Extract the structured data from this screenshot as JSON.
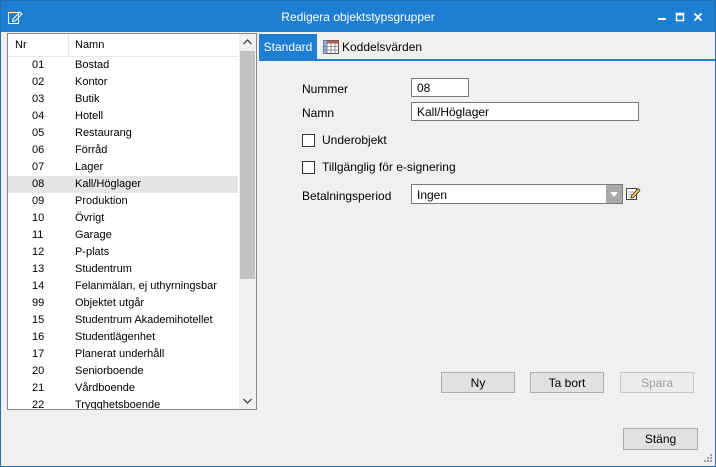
{
  "window": {
    "title": "Redigera objektstypsgrupper",
    "icons": {
      "app": "edit-note-icon",
      "minimize": "minimize-icon",
      "maximize": "maximize-icon",
      "close": "close-icon"
    },
    "accent_color": "#1e7fd2"
  },
  "list": {
    "columns": {
      "nr": "Nr",
      "name": "Namn"
    },
    "selected_nr": "08",
    "rows": [
      {
        "nr": "01",
        "name": "Bostad"
      },
      {
        "nr": "02",
        "name": "Kontor"
      },
      {
        "nr": "03",
        "name": "Butik"
      },
      {
        "nr": "04",
        "name": "Hotell"
      },
      {
        "nr": "05",
        "name": "Restaurang"
      },
      {
        "nr": "06",
        "name": "Förråd"
      },
      {
        "nr": "07",
        "name": "Lager"
      },
      {
        "nr": "08",
        "name": "Kall/Höglager"
      },
      {
        "nr": "09",
        "name": "Produktion"
      },
      {
        "nr": "10",
        "name": "Övrigt"
      },
      {
        "nr": "11",
        "name": "Garage"
      },
      {
        "nr": "12",
        "name": "P-plats"
      },
      {
        "nr": "13",
        "name": "Studentrum"
      },
      {
        "nr": "14",
        "name": "Felanmälan, ej uthyrningsbar"
      },
      {
        "nr": "99",
        "name": "Objektet utgår"
      },
      {
        "nr": "15",
        "name": "Studentrum Akademihotellet"
      },
      {
        "nr": "16",
        "name": "Studentlägenhet"
      },
      {
        "nr": "17",
        "name": "Planerat underhåll"
      },
      {
        "nr": "20",
        "name": "Seniorboende"
      },
      {
        "nr": "21",
        "name": "Vårdboende"
      },
      {
        "nr": "22",
        "name": "Trygghetsboende"
      }
    ]
  },
  "tabs": [
    {
      "label": "Standard",
      "active": true
    },
    {
      "label": "Koddelsvärden",
      "active": false,
      "icon": "table-grid-icon"
    }
  ],
  "form": {
    "nummer": {
      "label": "Nummer",
      "value": "08"
    },
    "namn": {
      "label": "Namn",
      "value": "Kall/Höglager"
    },
    "underobjekt": {
      "label": "Underobjekt",
      "checked": false
    },
    "esignering": {
      "label": "Tillgänglig för e-signering",
      "checked": false
    },
    "betalningsperiod": {
      "label": "Betalningsperiod",
      "value": "Ingen"
    }
  },
  "buttons": {
    "ny": "Ny",
    "tabort": "Ta bort",
    "spara": "Spara",
    "stang": "Stäng"
  }
}
